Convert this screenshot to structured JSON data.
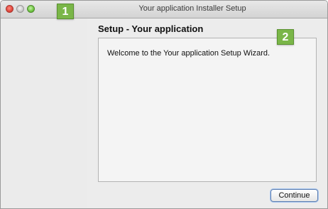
{
  "window": {
    "title": "Your application Installer Setup"
  },
  "main": {
    "heading": "Setup - Your application",
    "welcome_text": "Welcome to the Your application Setup Wizard."
  },
  "footer": {
    "continue_label": "Continue"
  },
  "annotations": {
    "badge_1": "1",
    "badge_2": "2"
  },
  "colors": {
    "badge_green": "#7ab648",
    "close_red": "#e0443a",
    "zoom_green": "#6cc43f",
    "focus_blue": "#5e7fb1"
  }
}
